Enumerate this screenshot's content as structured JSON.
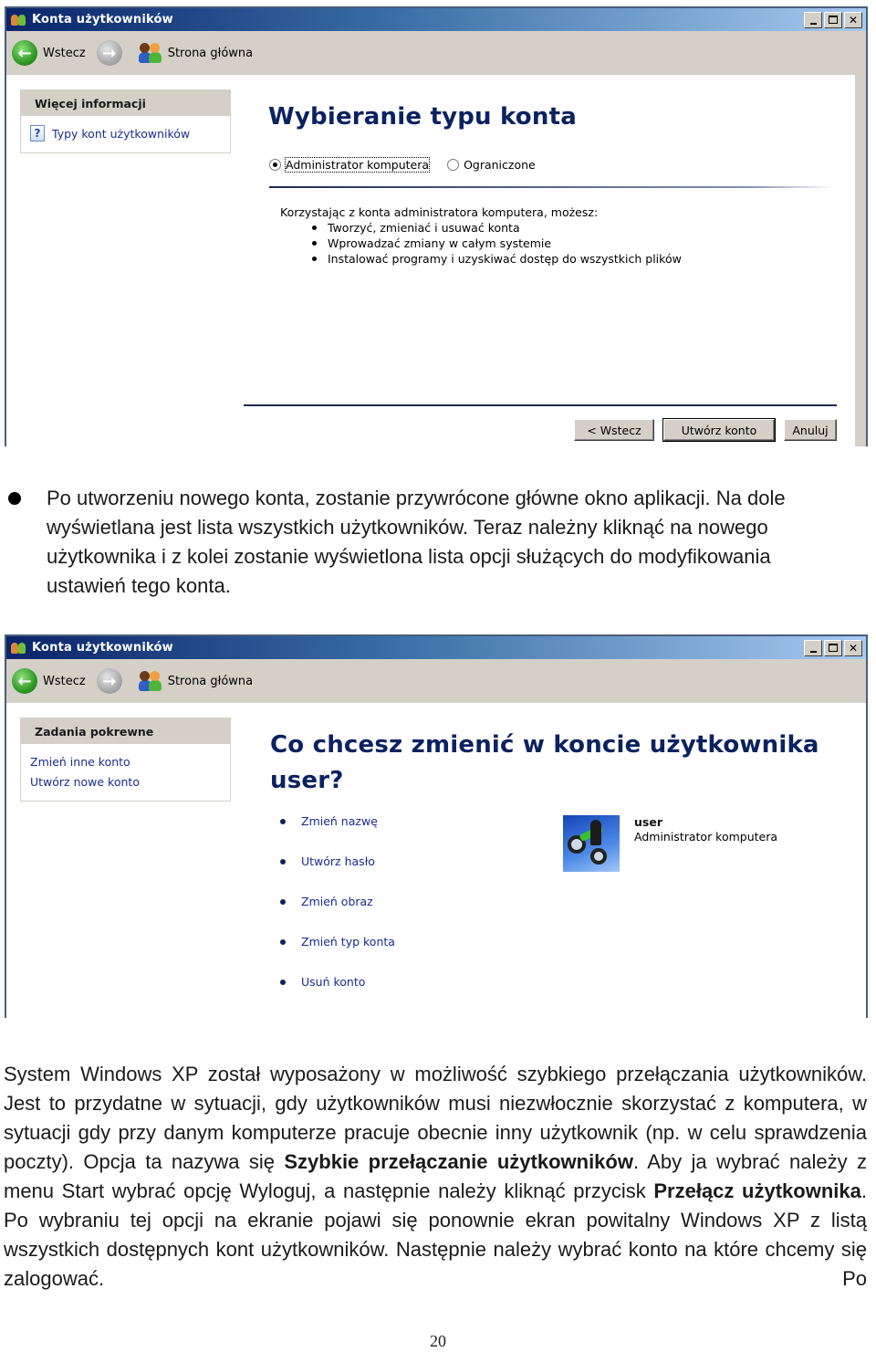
{
  "window1": {
    "title": "Konta użytkowników",
    "toolbar": {
      "back_label": "Wstecz",
      "home_label": "Strona główna"
    },
    "side_panel": {
      "header": "Więcej informacji",
      "links": [
        {
          "label": "Typy kont użytkowników",
          "icon": "help-icon"
        }
      ]
    },
    "heading": "Wybieranie typu konta",
    "radio_options": [
      {
        "label": "Administrator komputera",
        "selected": true
      },
      {
        "label": "Ograniczone",
        "selected": false
      }
    ],
    "description": {
      "intro": "Korzystając z konta administratora komputera, możesz:",
      "items": [
        "Tworzyć, zmieniać i usuwać konta",
        "Wprowadzać zmiany w całym systemie",
        "Instalować programy i uzyskiwać dostęp do wszystkich plików"
      ]
    },
    "buttons": {
      "back": "< Wstecz",
      "create": "Utwórz konto",
      "cancel": "Anuluj"
    }
  },
  "bullet_paragraph": "Po utworzeniu nowego konta, zostanie przywrócone główne okno aplikacji. Na dole wyświetlana jest lista wszystkich użytkowników. Teraz należny kliknąć na nowego użytkownika i z kolei zostanie wyświetlona lista opcji służących do modyfikowania ustawień tego konta.",
  "window2": {
    "title": "Konta użytkowników",
    "toolbar": {
      "back_label": "Wstecz",
      "home_label": "Strona główna"
    },
    "side_panel": {
      "header": "Zadania pokrewne",
      "links": [
        {
          "label": "Zmień inne konto"
        },
        {
          "label": "Utwórz nowe konto"
        }
      ]
    },
    "heading_line1": "Co chcesz zmienić w koncie użytkownika",
    "heading_line2": "user?",
    "tasks": [
      "Zmień nazwę",
      "Utwórz hasło",
      "Zmień obraz",
      "Zmień typ konta",
      "Usuń konto"
    ],
    "account": {
      "name": "user",
      "type": "Administrator komputera",
      "picture": "motocross-bike-picture"
    }
  },
  "body_paragraph": {
    "part1": "System Windows XP został wyposażony w możliwość szybkiego przełączania użytkowników. Jest to przydatne w sytuacji, gdy użytkowników musi niezwłocznie skorzystać z komputera, w sytuacji gdy przy danym komputerze pracuje obecnie inny użytkownik (np. w celu sprawdzenia poczty). Opcja ta nazywa się ",
    "bold1": "Szybkie przełączanie użytkowników",
    "part2": ". Aby ja wybrać należy z menu Start wybrać opcję Wyloguj, a następnie należy kliknąć przycisk ",
    "bold2": "Przełącz użytkownika",
    "part3": ". Po wybraniu tej opcji na ekranie pojawi się ponownie ekran powitalny Windows XP z listą wszystkich dostępnych kont użytkowników. Następnie należy wybrać konto na które chcemy się zalogować. Po"
  },
  "page_number": "20"
}
